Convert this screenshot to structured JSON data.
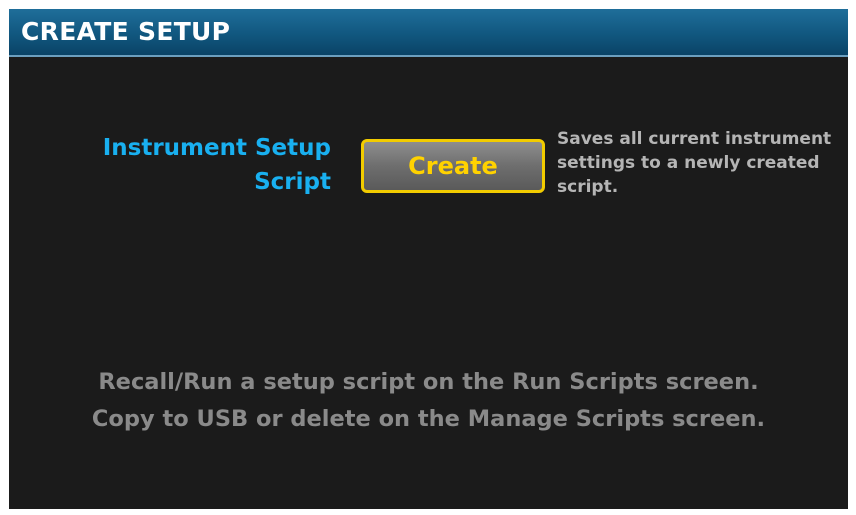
{
  "header": {
    "title": "CREATE SETUP"
  },
  "setup": {
    "label_line1": "Instrument Setup",
    "label_line2": "Script",
    "button_label": "Create",
    "description_line1": "Saves all current instrument",
    "description_line2": "settings to a newly created",
    "description_line3": "script."
  },
  "footer_note": {
    "line1": "Recall/Run a setup script on the Run Scripts screen.",
    "line2": "Copy to USB or delete on the Manage Scripts screen."
  },
  "colors": {
    "title_bar": "#11577f",
    "label_accent": "#19b0f0",
    "button_border": "#f2cc00",
    "button_text": "#ffd200",
    "background": "#1b1b1b"
  }
}
